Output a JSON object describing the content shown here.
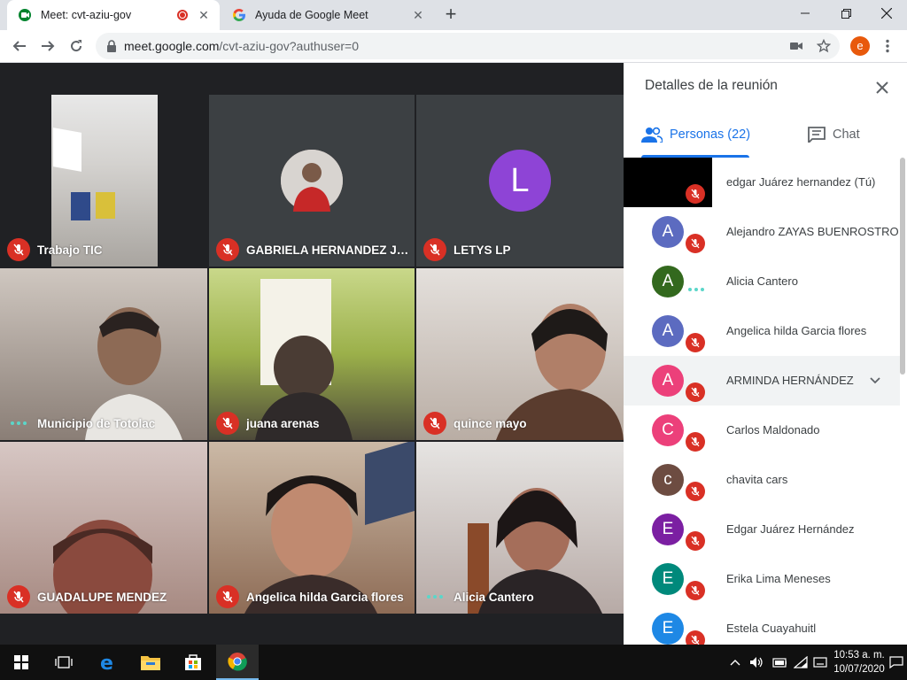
{
  "browser": {
    "tabs": [
      {
        "title": "Meet: cvt-aziu-gov",
        "active": true,
        "recording": true
      },
      {
        "title": "Ayuda de Google Meet",
        "active": false
      }
    ],
    "url_host": "meet.google.com",
    "url_path": "/cvt-aziu-gov?authuser=0",
    "profile_initial": "e"
  },
  "meet": {
    "tiles": [
      {
        "name": "Trabajo TIC",
        "status": "muted",
        "bg": "#6b6f76"
      },
      {
        "name": "GABRIELA HERNANDEZ JUA...",
        "status": "muted",
        "bg": "#3c4043",
        "avatar": "photo",
        "avatar_color": "#c9a9a0"
      },
      {
        "name": "LETYS LP",
        "status": "muted",
        "bg": "#3c4043",
        "avatar": "L",
        "avatar_color": "#8e44d6"
      },
      {
        "name": "Municipio de Totolac",
        "status": "speaking",
        "bg": "#7d7570"
      },
      {
        "name": "juana arenas",
        "status": "muted",
        "bg": "#7c8a3c"
      },
      {
        "name": "quince mayo",
        "status": "muted",
        "bg": "#8a7060"
      },
      {
        "name": "GUADALUPE MENDEZ",
        "status": "muted",
        "bg": "#a57a72"
      },
      {
        "name": "Angelica hilda Garcia flores",
        "status": "muted",
        "bg": "#8d735f"
      },
      {
        "name": "Alicia Cantero",
        "status": "speaking",
        "bg": "#9a8a86"
      }
    ]
  },
  "panel": {
    "title": "Detalles de la reunión",
    "tab_people": "Personas (22)",
    "tab_chat": "Chat",
    "participants": [
      {
        "name": "edgar Juárez hernandez (Tú)",
        "initial": "",
        "color": "#000000",
        "status": "muted",
        "self": true
      },
      {
        "name": "Alejandro ZAYAS BUENROSTRO",
        "initial": "A",
        "color": "#5c6bc0",
        "status": "muted"
      },
      {
        "name": "Alicia Cantero",
        "initial": "A",
        "color": "#33691e",
        "status": "speaking"
      },
      {
        "name": "Angelica hilda Garcia flores",
        "initial": "A",
        "color": "#5c6bc0",
        "status": "muted"
      },
      {
        "name": "ARMINDA HERNÁNDEZ",
        "initial": "A",
        "color": "#ec407a",
        "status": "muted",
        "hover": true
      },
      {
        "name": "Carlos Maldonado",
        "initial": "C",
        "color": "#ec407a",
        "status": "muted"
      },
      {
        "name": "chavita cars",
        "initial": "c",
        "color": "#6d4c41",
        "status": "muted"
      },
      {
        "name": "Edgar Juárez Hernández",
        "initial": "E",
        "color": "#7b1fa2",
        "status": "muted"
      },
      {
        "name": "Erika Lima Meneses",
        "initial": "E",
        "color": "#00897b",
        "status": "muted"
      },
      {
        "name": "Estela Cuayahuitl",
        "initial": "E",
        "color": "#1e88e5",
        "status": "muted"
      }
    ]
  },
  "taskbar": {
    "time": "10:53 a. m.",
    "date": "10/07/2020"
  }
}
